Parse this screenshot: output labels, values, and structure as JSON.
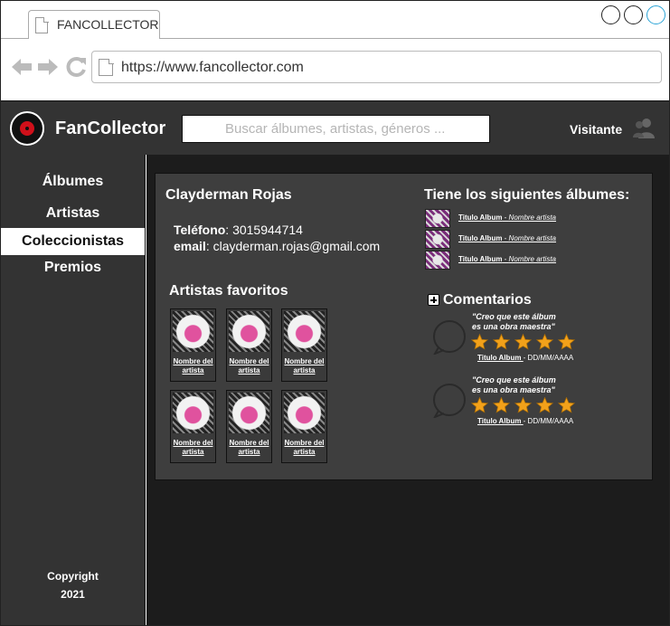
{
  "browser": {
    "tab_title": "FANCOLLECTOR",
    "url": "https://www.fancollector.com"
  },
  "header": {
    "brand": "FanCollector",
    "search_placeholder": "Buscar álbumes, artistas, géneros ...",
    "user_label": "Visitante"
  },
  "sidebar": {
    "items": [
      {
        "label": "Álbumes",
        "active": false
      },
      {
        "label": "Artistas",
        "active": false
      },
      {
        "label": "Coleccionistas",
        "active": true
      },
      {
        "label": "Premios",
        "active": false
      }
    ],
    "copyright_line1": "Copyright",
    "copyright_line2": "2021"
  },
  "profile": {
    "name": "Clayderman Rojas",
    "phone_label": "Teléfono",
    "phone": "3015944714",
    "email_label": "email",
    "email": "clayderman.rojas@gmail.com",
    "favorites_title": "Artistas favoritos",
    "favorite_artists": [
      {
        "name": "Nombre del artista"
      },
      {
        "name": "Nombre del artista"
      },
      {
        "name": "Nombre del artista"
      },
      {
        "name": "Nombre del artista"
      },
      {
        "name": "Nombre del artista"
      },
      {
        "name": "Nombre del artista"
      }
    ],
    "albums_title": "Tiene los siguientes álbumes:",
    "albums": [
      {
        "title": "Titulo Album",
        "sep": " - ",
        "artist": "Nombre artista"
      },
      {
        "title": "Titulo Album",
        "sep": " - ",
        "artist": "Nombre artista"
      },
      {
        "title": "Titulo Album",
        "sep": " - ",
        "artist": "Nombre artista"
      }
    ],
    "comments_title": "Comentarios",
    "comments": [
      {
        "line1": "\"Creo que este álbum",
        "line2": "es una obra maestra\"",
        "rating": 5,
        "album": "Titulo Album ",
        "date": "- DD/MM/AAAA"
      },
      {
        "line1": "\"Creo que este álbum",
        "line2": "es una obra maestra\"",
        "rating": 5,
        "album": "Titulo Album ",
        "date": "- DD/MM/AAAA"
      }
    ]
  },
  "colors": {
    "header_bg": "#333333",
    "main_bg": "#1c1c1c",
    "panel_bg": "#3e3e3e",
    "star": "#f2a11a",
    "logo_red": "#d0101a"
  }
}
